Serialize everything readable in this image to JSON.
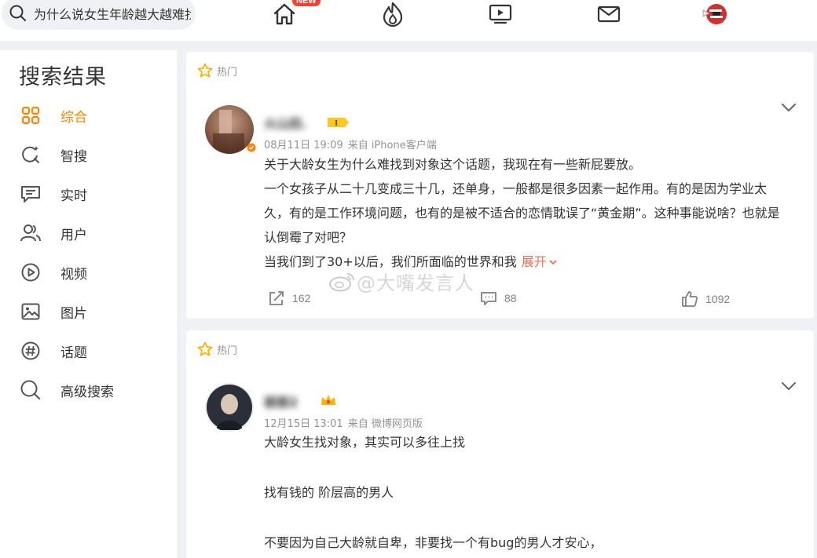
{
  "search": {
    "query": "为什么说女生年龄越大越难找对象"
  },
  "nav": {
    "new_badge": "NEW",
    "icons": [
      "home-icon",
      "hot-icon",
      "video-icon",
      "mail-icon",
      "avatar-icon"
    ]
  },
  "sidebar": {
    "title": "搜索结果",
    "items": [
      {
        "label": "综合",
        "icon": "grid-icon",
        "active": true
      },
      {
        "label": "智搜",
        "icon": "smart-search-icon"
      },
      {
        "label": "实时",
        "icon": "realtime-icon"
      },
      {
        "label": "用户",
        "icon": "users-icon"
      },
      {
        "label": "视频",
        "icon": "play-icon"
      },
      {
        "label": "图片",
        "icon": "image-icon"
      },
      {
        "label": "话题",
        "icon": "hashtag-icon"
      },
      {
        "label": "高级搜索",
        "icon": "search-icon"
      }
    ]
  },
  "posts": [
    {
      "tag": "热门",
      "username": "火山田.",
      "time": "08月11日 19:09",
      "source": "来自 iPhone客户端",
      "paragraphs": [
        "关于大龄女生为什么难找到对象这个话题，我现在有一些新屁要放。",
        "一个女孩子从二十几变成三十几，还单身，一般都是很多因素一起作用。有的是因为学业太久，有的是工作环境问题，也有的是被不适合的恋情耽误了“黄金期”。这种事能说啥？也就是认倒霉了对吧？",
        "当我们到了30+以后，我们所面临的世界和我"
      ],
      "expand_label": "展开",
      "reposts": "162",
      "comments": "88",
      "likes": "1092"
    },
    {
      "tag": "热门",
      "username": "丽丽2",
      "time": "12月15日 13:01",
      "source": "来自 微博网页版",
      "paragraphs": [
        "大龄女生找对象，其实可以多往上找",
        "找有钱的 阶层高的男人",
        "不要因为自己大龄就自卑，非要找一个有bug的男人才安心，"
      ]
    }
  ],
  "watermark": "@大嘴发言人",
  "colors": {
    "accent": "#ff8200",
    "expand": "#eb7350",
    "meta": "#939393",
    "badge": "#ff3f2e"
  }
}
